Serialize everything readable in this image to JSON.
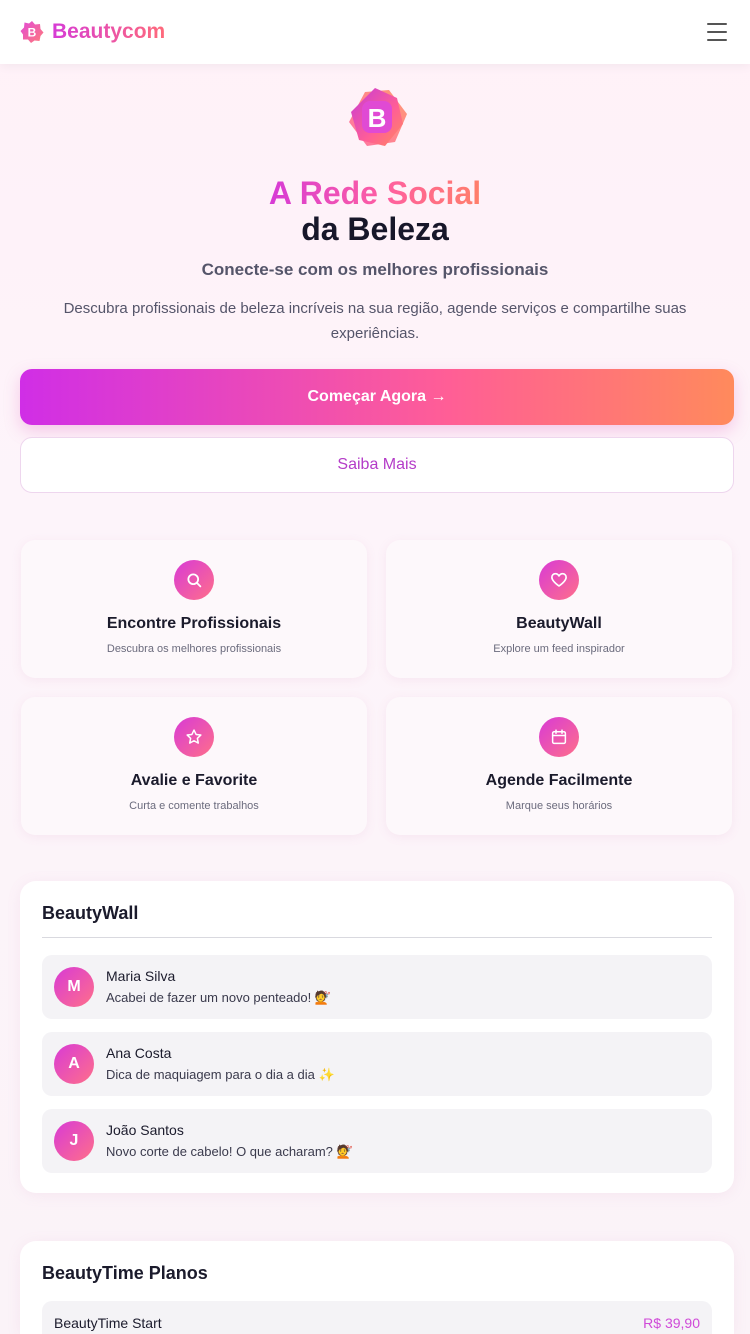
{
  "header": {
    "brand_name": "Beautycom",
    "menu_icon": "hamburger-menu-icon"
  },
  "hero": {
    "logo_icon": "beautycom-logo-icon",
    "title_line1": "A Rede Social",
    "title_line2": "da Beleza",
    "subtitle": "Conecte-se com os melhores profissionais",
    "description": "Descubra profissionais de beleza incríveis na sua região, agende serviços e compartilhe suas experiências.",
    "primary_button": "Começar Agora →",
    "secondary_button": "Saiba Mais"
  },
  "features": [
    {
      "icon": "search-icon",
      "title": "Encontre Profissionais",
      "desc": "Descubra os melhores profissionais"
    },
    {
      "icon": "heart-icon",
      "title": "BeautyWall",
      "desc": "Explore um feed inspirador"
    },
    {
      "icon": "star-icon",
      "title": "Avalie e Favorite",
      "desc": "Curta e comente trabalhos"
    },
    {
      "icon": "calendar-icon",
      "title": "Agende Facilmente",
      "desc": "Marque seus horários"
    }
  ],
  "beautywall": {
    "title": "BeautyWall",
    "posts": [
      {
        "initial": "M",
        "name": "Maria Silva",
        "text": "Acabei de fazer um novo penteado! 💇"
      },
      {
        "initial": "A",
        "name": "Ana Costa",
        "text": "Dica de maquiagem para o dia a dia ✨"
      },
      {
        "initial": "J",
        "name": "João Santos",
        "text": "Novo corte de cabelo! O que acharam? 💇"
      }
    ]
  },
  "plans": {
    "title": "BeautyTime Planos",
    "items": [
      {
        "name": "BeautyTime Start",
        "price": "R$ 39,90"
      }
    ]
  },
  "colors": {
    "brand_gradient_start": "#d02ee6",
    "brand_gradient_end": "#ff8a5c",
    "accent_text": "#b43cc8"
  }
}
